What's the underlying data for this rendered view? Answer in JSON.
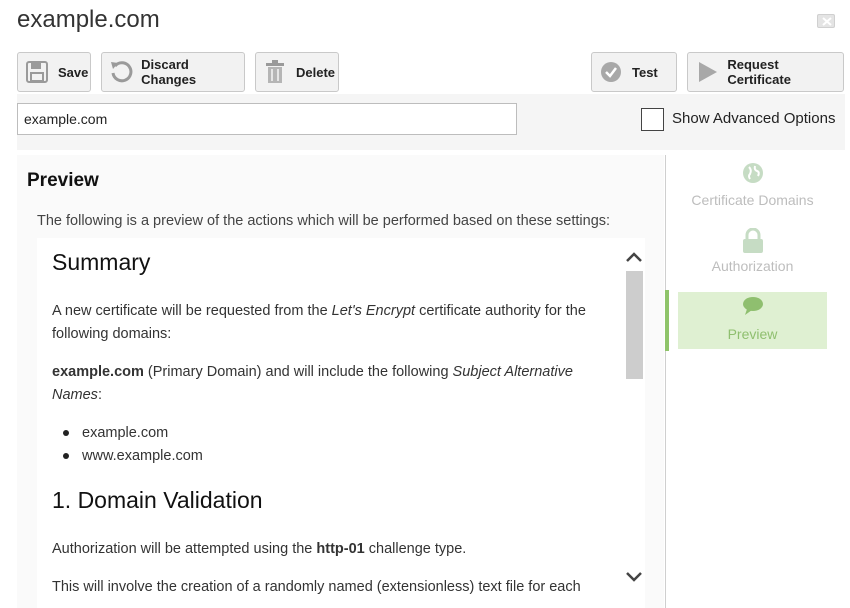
{
  "window": {
    "title": "example.com"
  },
  "toolbar": {
    "save": "Save",
    "discard": "Discard Changes",
    "delete": "Delete",
    "test": "Test",
    "request": "Request Certificate"
  },
  "settings": {
    "name_value": "example.com",
    "show_advanced_label": "Show Advanced Options",
    "show_advanced_checked": false
  },
  "main": {
    "title": "Preview",
    "subtitle": "The following is a preview of the actions which will be performed based on these settings:"
  },
  "preview": {
    "summary_heading": "Summary",
    "p1_before": "A new certificate will be requested from the ",
    "p1_em": "Let's Encrypt",
    "p1_after": " certificate authority for the following domains:",
    "p2_bold": "example.com",
    "p2_mid": " (Primary Domain) and will include the following ",
    "p2_em": "Subject Alternative Names",
    "p2_end": ":",
    "domains": [
      "example.com",
      "www.example.com"
    ],
    "domain_validation_heading": "1. Domain Validation",
    "p3_before": "Authorization will be attempted using the ",
    "p3_bold": "http-01",
    "p3_after": " challenge type.",
    "p4": "This will involve the creation of a randomly named (extensionless) text file for each"
  },
  "sidebar": {
    "items": [
      {
        "label": "Certificate Domains",
        "icon": "globe-icon"
      },
      {
        "label": "Authorization",
        "icon": "lock-icon"
      },
      {
        "label": "Preview",
        "icon": "speech-bubble-icon"
      }
    ],
    "active_index": 2
  },
  "colors": {
    "active_nav_bg": "#dff0d2",
    "active_nav_accent": "#8fc46a",
    "icon_green": "#8fbf6f"
  }
}
